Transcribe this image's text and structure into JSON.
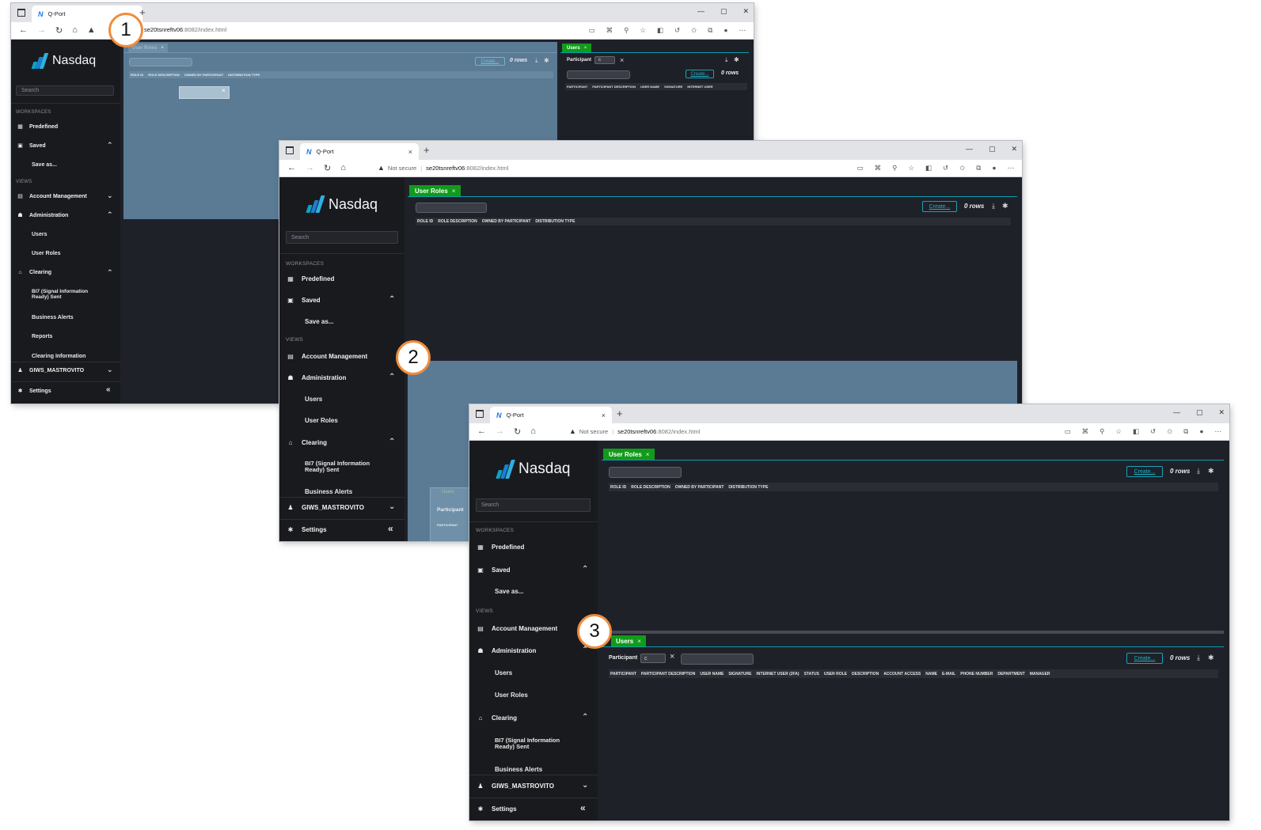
{
  "browser": {
    "tab_title": "Q-Port",
    "not_secure": "Not secure",
    "url_host": "se20tsnreftv06",
    "url_path": ":8082/index.html",
    "url_host_short": "se20tsnreftv06",
    "new_tab": "+",
    "close_tab": "×"
  },
  "sidebar": {
    "brand": "Nasdaq",
    "search_placeholder": "Search",
    "workspaces_label": "WORKSPACES",
    "views_label": "VIEWS",
    "predefined": "Predefined",
    "saved": "Saved",
    "save_as": "Save as...",
    "account_management": "Account Management",
    "administration": "Administration",
    "users": "Users",
    "user_roles": "User Roles",
    "clearing": "Clearing",
    "bi7": "BI7 (Signal Information Ready) Sent",
    "business_alerts": "Business Alerts",
    "reports": "Reports",
    "clearing_information": "Clearing Information",
    "user": "GIWS_MASTROVITO",
    "settings": "Settings",
    "collapse": "«"
  },
  "user_roles_panel": {
    "tab": "User Roles",
    "create": "Create...",
    "rows": "0 rows",
    "columns": [
      "ROLE ID",
      "ROLE DESCRIPTION",
      "OWNED BY PARTICIPANT",
      "DISTRIBUTION TYPE"
    ]
  },
  "users_panel": {
    "tab": "Users",
    "participant_label": "Participant",
    "participant_value": "c",
    "create": "Create...",
    "rows": "0 rows",
    "columns_short": [
      "PARTICIPANT",
      "PARTICIPANT DESCRIPTION",
      "USER NAME",
      "SIGNATURE",
      "INTERNET USER"
    ],
    "columns": [
      "PARTICIPANT",
      "PARTICIPANT DESCRIPTION",
      "USER NAME",
      "SIGNATURE",
      "INTERNET USER (2FA)",
      "STATUS",
      "USER ROLE",
      "DESCRIPTION",
      "ACCOUNT ACCESS",
      "NAME",
      "E-MAIL",
      "PHONE NUMBER",
      "DEPARTMENT",
      "MANAGER"
    ]
  },
  "callouts": [
    "1",
    "2",
    "3"
  ],
  "colors": {
    "accent_green": "#119b1a",
    "accent_cyan": "#1ab3c8",
    "callout_orange": "#f08c3a",
    "sidebar_bg": "#191a1e",
    "panel_bg": "#1f2129",
    "blue_area": "#5b7b95"
  }
}
